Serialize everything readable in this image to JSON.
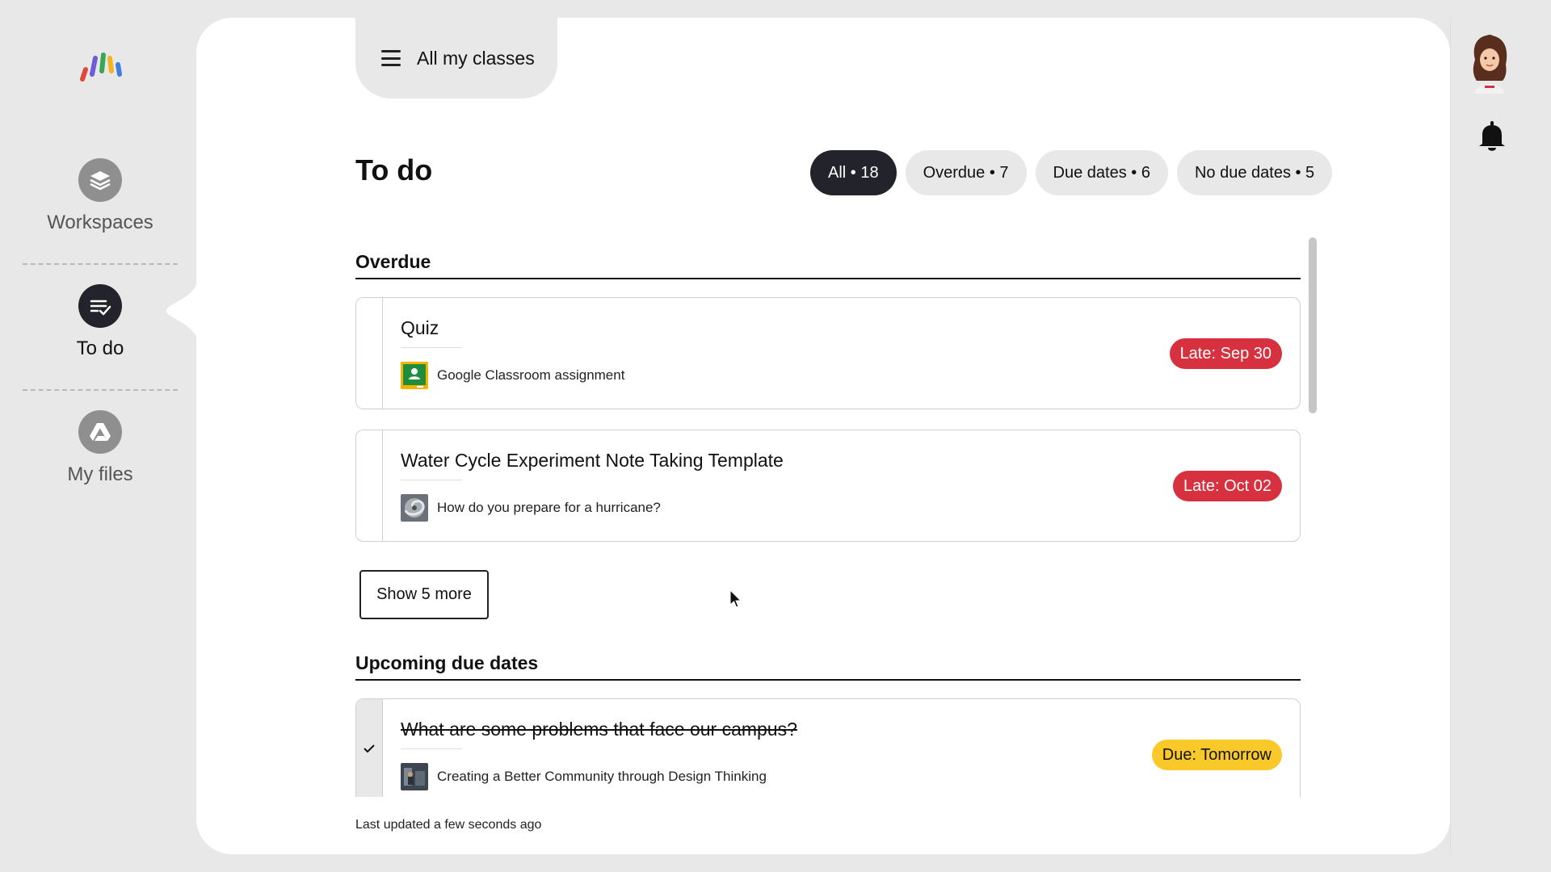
{
  "nav": {
    "items": [
      {
        "label": "Workspaces",
        "icon": "layers-icon"
      },
      {
        "label": "To do",
        "icon": "checklist-icon"
      },
      {
        "label": "My files",
        "icon": "drive-icon"
      }
    ]
  },
  "header": {
    "class_selector": "All my classes",
    "page_title": "To do"
  },
  "filters": [
    {
      "label": "All • 18",
      "active": true
    },
    {
      "label": "Overdue • 7",
      "active": false
    },
    {
      "label": "Due dates • 6",
      "active": false
    },
    {
      "label": "No due dates • 5",
      "active": false
    }
  ],
  "sections": {
    "overdue": {
      "heading": "Overdue",
      "cards": [
        {
          "title": "Quiz",
          "subtitle": "Google Classroom assignment",
          "badge": "Late: Sep 30",
          "thumb": "google-classroom-icon"
        },
        {
          "title": "Water Cycle Experiment Note Taking Template",
          "subtitle": "How do you prepare for a hurricane?",
          "badge": "Late: Oct 02",
          "thumb": "hurricane-thumbnail"
        }
      ],
      "show_more": "Show 5 more"
    },
    "upcoming": {
      "heading": "Upcoming due dates",
      "cards": [
        {
          "title": "What are some problems that face our campus?",
          "subtitle": "Creating a Better Community through Design Thinking",
          "badge": "Due: Tomorrow",
          "thumb": "community-thumbnail",
          "completed": true
        }
      ]
    }
  },
  "footer": {
    "last_updated": "Last updated a few seconds ago"
  },
  "colors": {
    "late": "#d7303e",
    "due": "#f8c929",
    "active_chip": "#23242b"
  }
}
